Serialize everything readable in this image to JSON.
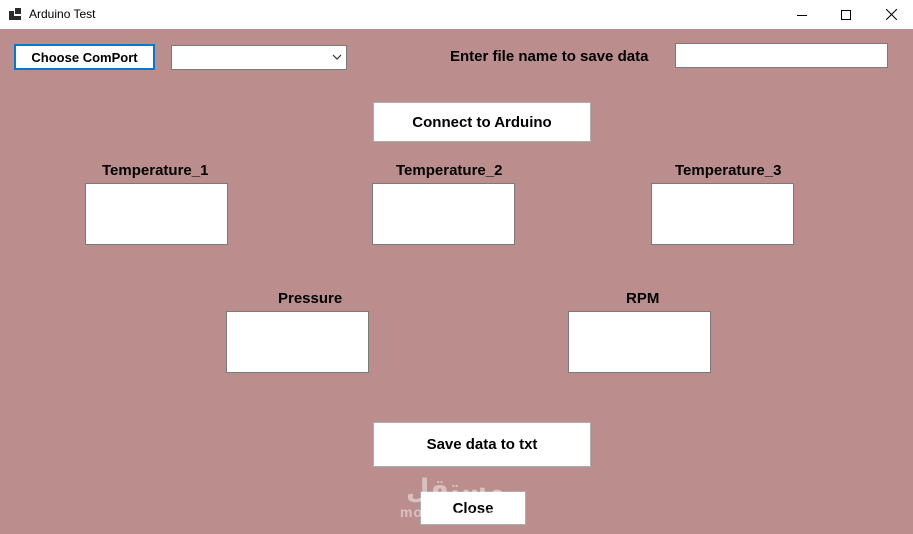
{
  "window": {
    "title": "Arduino Test",
    "icon": "app-window-icon",
    "controls": [
      "minimize-icon",
      "maximize-icon",
      "close-icon"
    ]
  },
  "top": {
    "choose_comport_label": "Choose ComPort",
    "comport_selected": "",
    "file_name_label": "Enter file name to save data",
    "file_name_value": ""
  },
  "connect_label": "Connect to Arduino",
  "readings": {
    "temperature_1": {
      "label": "Temperature_1",
      "value": ""
    },
    "temperature_2": {
      "label": "Temperature_2",
      "value": ""
    },
    "temperature_3": {
      "label": "Temperature_3",
      "value": ""
    },
    "pressure": {
      "label": "Pressure",
      "value": ""
    },
    "rpm": {
      "label": "RPM",
      "value": ""
    }
  },
  "save_label": "Save data to txt",
  "close_label": "Close",
  "watermark": {
    "mark": "مستقل",
    "text": "mostaql.com"
  },
  "colors": {
    "form_background": "#bb8e8d",
    "focus_border": "#0078d7"
  }
}
